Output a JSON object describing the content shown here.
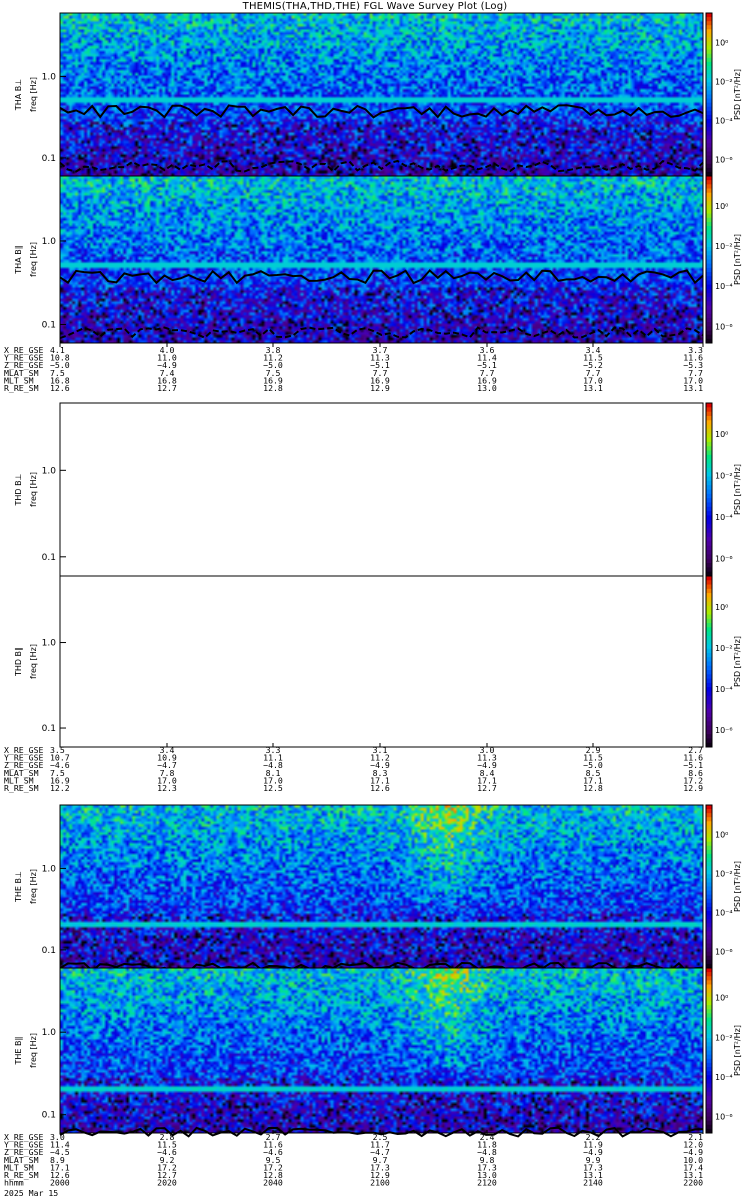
{
  "title": "THEMIS(THA,THD,THE) FGL Wave Survey Plot (Log)",
  "colors": {
    "background": "#ffffff",
    "axis": "#000000",
    "line": "#000000"
  },
  "chart_data": [
    {
      "type": "heatmap",
      "panel": "THA B⊥",
      "ylabel": "THA B⊥",
      "ylabel2": "freq [Hz]",
      "yscale": "log",
      "ylim": [
        0.06,
        6
      ],
      "yticks": [
        "0.1",
        "1.0"
      ],
      "colorbar_label": "PSD [nT²/Hz]",
      "colorbar_ticks": [
        "10⁰",
        "10⁻²",
        "10⁻⁴",
        "10⁻⁶"
      ],
      "has_data": true
    },
    {
      "type": "heatmap",
      "panel": "THA B∥",
      "ylabel": "THA B∥",
      "ylabel2": "freq [Hz]",
      "yscale": "log",
      "ylim": [
        0.06,
        6
      ],
      "yticks": [
        "0.1",
        "1.0"
      ],
      "colorbar_label": "PSD [nT²/Hz]",
      "colorbar_ticks": [
        "10⁰",
        "10⁻²",
        "10⁻⁴",
        "10⁻⁶"
      ],
      "has_data": true
    },
    {
      "type": "heatmap",
      "panel": "THD B⊥",
      "ylabel": "THD B⊥",
      "ylabel2": "freq [Hz]",
      "yscale": "log",
      "ylim": [
        0.06,
        6
      ],
      "yticks": [
        "0.1",
        "1.0"
      ],
      "colorbar_label": "PSD [nT²/Hz]",
      "colorbar_ticks": [
        "10⁰",
        "10⁻²",
        "10⁻⁴",
        "10⁻⁶"
      ],
      "has_data": false
    },
    {
      "type": "heatmap",
      "panel": "THD B∥",
      "ylabel": "THD B∥",
      "ylabel2": "freq [Hz]",
      "yscale": "log",
      "ylim": [
        0.06,
        6
      ],
      "yticks": [
        "0.1",
        "1.0"
      ],
      "colorbar_label": "PSD [nT²/Hz]",
      "colorbar_ticks": [
        "10⁰",
        "10⁻²",
        "10⁻⁴",
        "10⁻⁶"
      ],
      "has_data": false
    },
    {
      "type": "heatmap",
      "panel": "THE B⊥",
      "ylabel": "THE B⊥",
      "ylabel2": "freq [Hz]",
      "yscale": "log",
      "ylim": [
        0.06,
        6
      ],
      "yticks": [
        "0.1",
        "1.0"
      ],
      "colorbar_label": "PSD [nT²/Hz]",
      "colorbar_ticks": [
        "10⁰",
        "10⁻²",
        "10⁻⁴",
        "10⁻⁶"
      ],
      "has_data": true
    },
    {
      "type": "heatmap",
      "panel": "THE B∥",
      "ylabel": "THE B∥",
      "ylabel2": "freq [Hz]",
      "yscale": "log",
      "ylim": [
        0.06,
        6
      ],
      "yticks": [
        "0.1",
        "1.0"
      ],
      "colorbar_label": "PSD [nT²/Hz]",
      "colorbar_ticks": [
        "10⁰",
        "10⁻²",
        "10⁻⁴",
        "10⁻⁶"
      ],
      "has_data": true
    }
  ],
  "ephemeris": [
    {
      "rows": [
        [
          "X_RE_GSE",
          "4.1",
          "4.0",
          "3.8",
          "3.7",
          "3.6",
          "3.4",
          "3.3"
        ],
        [
          "Y_RE_GSE",
          "10.8",
          "11.0",
          "11.2",
          "11.3",
          "11.4",
          "11.5",
          "11.6"
        ],
        [
          "Z_RE_GSE",
          "−5.0",
          "−4.9",
          "−5.0",
          "−5.1",
          "−5.1",
          "−5.2",
          "−5.3"
        ],
        [
          "MLAT_SM",
          "7.5",
          "7.4",
          "7.5",
          "7.7",
          "7.7",
          "7.7",
          "7.7"
        ],
        [
          "MLT_SM",
          "16.8",
          "16.8",
          "16.9",
          "16.9",
          "16.9",
          "17.0",
          "17.0"
        ],
        [
          "R_RE_SM",
          "12.6",
          "12.7",
          "12.8",
          "12.9",
          "13.0",
          "13.1",
          "13.1"
        ]
      ]
    },
    {
      "rows": [
        [
          "X_RE_GSE",
          "3.5",
          "3.4",
          "3.3",
          "3.1",
          "3.0",
          "2.9",
          "2.7"
        ],
        [
          "Y_RE_GSE",
          "10.7",
          "10.9",
          "11.1",
          "11.2",
          "11.3",
          "11.5",
          "11.6"
        ],
        [
          "Z_RE_GSE",
          "−4.6",
          "−4.7",
          "−4.8",
          "−4.9",
          "−4.9",
          "−5.0",
          "−5.1"
        ],
        [
          "MLAT_SM",
          "7.5",
          "7.8",
          "8.1",
          "8.3",
          "8.4",
          "8.5",
          "8.6"
        ],
        [
          "MLT_SM",
          "16.9",
          "17.0",
          "17.0",
          "17.1",
          "17.1",
          "17.1",
          "17.2"
        ],
        [
          "R_RE_SM",
          "12.2",
          "12.3",
          "12.5",
          "12.6",
          "12.7",
          "12.8",
          "12.9"
        ]
      ]
    },
    {
      "rows": [
        [
          "X_RE_GSE",
          "3.0",
          "2.8",
          "2.7",
          "2.5",
          "2.4",
          "2.2",
          "2.1"
        ],
        [
          "Y_RE_GSE",
          "11.4",
          "11.5",
          "11.6",
          "11.7",
          "11.8",
          "11.9",
          "12.0"
        ],
        [
          "Z_RE_GSE",
          "−4.5",
          "−4.6",
          "−4.6",
          "−4.7",
          "−4.8",
          "−4.9",
          "−4.9"
        ],
        [
          "MLAT_SM",
          "8.9",
          "9.2",
          "9.5",
          "9.7",
          "9.8",
          "9.9",
          "10.0"
        ],
        [
          "MLT_SM",
          "17.1",
          "17.2",
          "17.2",
          "17.3",
          "17.3",
          "17.3",
          "17.4"
        ],
        [
          "R_RE_SM",
          "12.6",
          "12.7",
          "12.8",
          "12.9",
          "13.0",
          "13.1",
          "13.1"
        ],
        [
          "hhmm",
          "2000",
          "2020",
          "2040",
          "2100",
          "2120",
          "2140",
          "2200"
        ]
      ]
    }
  ],
  "date_label": "2025 Mar 15"
}
